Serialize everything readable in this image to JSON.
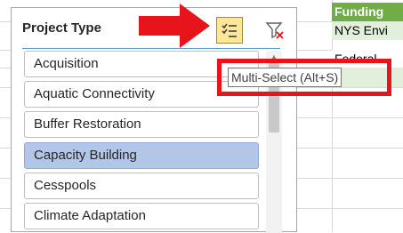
{
  "spreadsheet": {
    "header": "Funding",
    "cells": [
      "NYS Envi",
      "Federal",
      ""
    ]
  },
  "slicer": {
    "title": "Project Type",
    "items": [
      {
        "label": "Acquisition",
        "selected": false
      },
      {
        "label": "Aquatic Connectivity",
        "selected": false
      },
      {
        "label": "Buffer Restoration",
        "selected": false
      },
      {
        "label": "Capacity Building",
        "selected": true
      },
      {
        "label": "Cesspools",
        "selected": false
      },
      {
        "label": "Climate Adaptation",
        "selected": false
      }
    ],
    "multi_select_icon": "multi-select-icon",
    "clear_filter_icon": "clear-filter-icon"
  },
  "tooltip": {
    "text": "Multi-Select (Alt+S)"
  },
  "colors": {
    "funding_header": "#70ad47",
    "selected_item": "#b4c6e7",
    "multi_select_active": "#ffe699",
    "annotation_red": "#e8141c"
  }
}
